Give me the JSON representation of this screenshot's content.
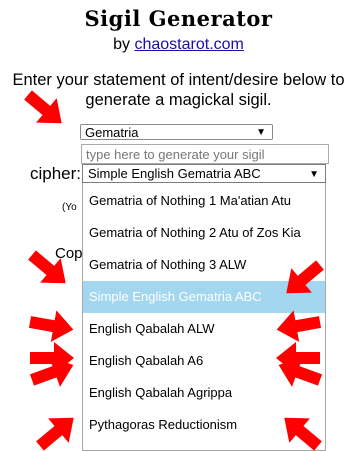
{
  "header": {
    "title": "Sigil Generator",
    "by_prefix": "by",
    "by_link": "chaostarot.com"
  },
  "intro_text": "Enter your statement of intent/desire below to generate a magickal sigil.",
  "method_select": {
    "value": "Gematria"
  },
  "intent_input": {
    "placeholder": "type here to generate your sigil"
  },
  "cipher": {
    "label": "cipher:",
    "selected": "Simple English Gematria ABC",
    "options": [
      "Gematria of Nothing 1 Ma'atian Atu",
      "Gematria of Nothing 2 Atu of Zos Kia",
      "Gematria of Nothing 3 ALW",
      "Simple English Gematria ABC",
      "English Qabalah ALW",
      "English Qabalah A6",
      "English Qabalah Agrippa",
      "Pythagoras Reductionism"
    ],
    "highlighted_index": 3
  },
  "partial_text": {
    "line1": "(Yo",
    "line2": "Cop"
  },
  "colors": {
    "arrow": "#ff0000",
    "highlight": "#a3d6ef",
    "link": "#1a0dab"
  },
  "icons": {
    "dropdown": "caret-down-icon",
    "annotation": "red-arrow-icon"
  }
}
